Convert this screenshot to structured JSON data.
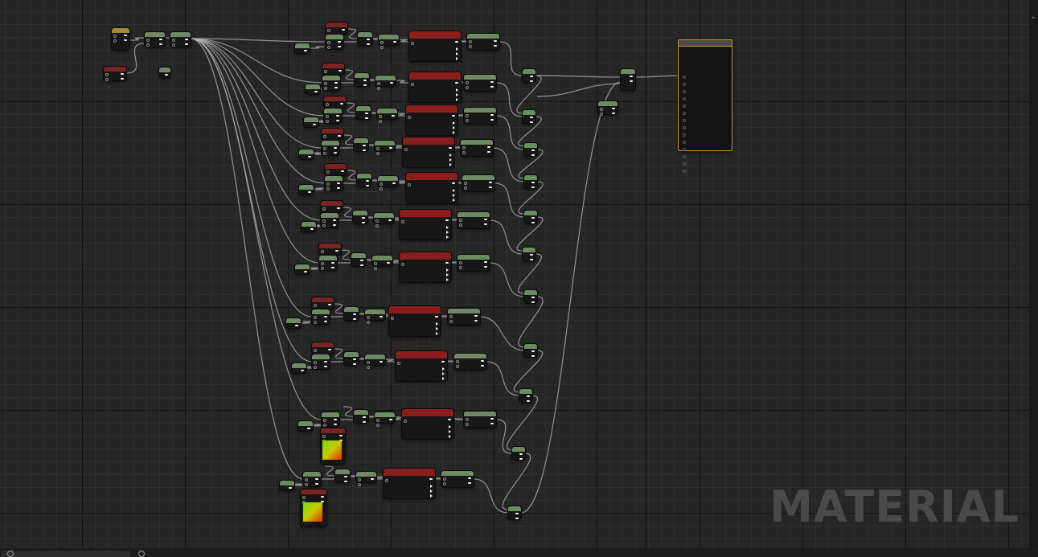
{
  "watermark": {
    "text": "MATERIAL"
  }
}
